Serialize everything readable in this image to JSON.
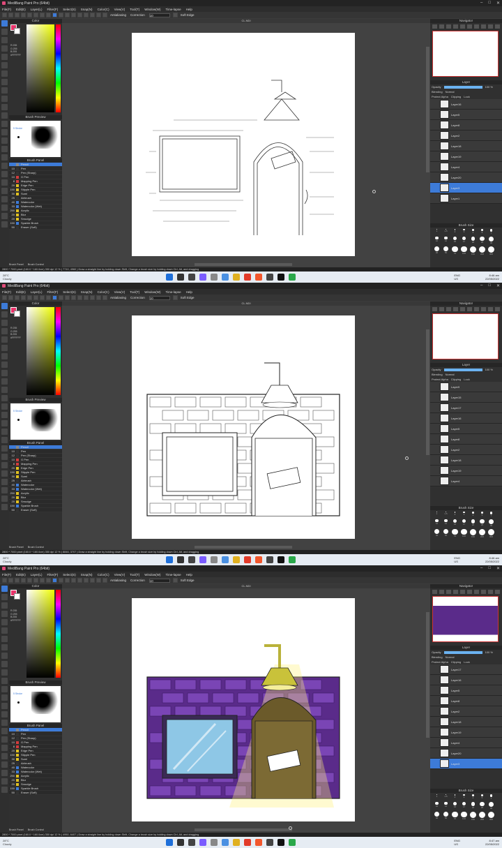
{
  "app": {
    "title": "MediBang Paint Pro (64bit)",
    "menu": [
      "File(F)",
      "Edit(E)",
      "Layer(L)",
      "Filter(F)",
      "Select(S)",
      "Snap(N)",
      "Color(C)",
      "View(V)",
      "Tool(T)",
      "Window(W)",
      "Time-lapse",
      "Help"
    ],
    "toolbar": {
      "antialias": "Antialiasing",
      "correction": "Correction",
      "correction_value": "10",
      "soft_edge": "Soft Edge"
    },
    "canvas_name": "CL.NDI"
  },
  "color_panel": {
    "title": "Color",
    "values": [
      "R:255",
      "G:255",
      "B:255"
    ],
    "hex": "#FFFFFF"
  },
  "brush_preview": {
    "title": "Brush Preview",
    "size": "5 Stroke"
  },
  "brush_panel": {
    "title": "Brush Panel",
    "items": [
      {
        "n": "",
        "name": "Pencil",
        "color": "#888888"
      },
      {
        "n": "10",
        "name": "Pen",
        "color": "#333333"
      },
      {
        "n": "12",
        "name": "Pen (Sharp)",
        "color": "#333333"
      },
      {
        "n": "10",
        "name": "G Pen",
        "color": "#d23b3b"
      },
      {
        "n": "8",
        "name": "Mapping Pen",
        "color": "#d23b3b"
      },
      {
        "n": "20",
        "name": "Edge Pen",
        "color": "#e0c020"
      },
      {
        "n": "150",
        "name": "Stipple Pen",
        "color": "#e0c020"
      },
      {
        "n": "30",
        "name": "Sumi",
        "color": "#e0c020"
      },
      {
        "n": "25",
        "name": "Airbrush",
        "color": "#333333"
      },
      {
        "n": "40",
        "name": "Watercolor",
        "color": "#3d7bd8"
      },
      {
        "n": "33",
        "name": "Watercolor (Wet)",
        "color": "#3d7bd8"
      },
      {
        "n": "250",
        "name": "Acrylic",
        "color": "#e0c020"
      },
      {
        "n": "20",
        "name": "Blur",
        "color": "#e0c020"
      },
      {
        "n": "20",
        "name": "Smudge",
        "color": "#e0c020"
      },
      {
        "n": "150",
        "name": "Sparkle Brush",
        "color": "#3d7bd8"
      },
      {
        "n": "50",
        "name": "Eraser (Soft)",
        "color": "#333333"
      }
    ],
    "tabs": [
      "Brush Panel",
      "Brush Control"
    ]
  },
  "navigator": {
    "title": "Navigator"
  },
  "layer_panel": {
    "title": "Layer",
    "opacity_label": "Opacity",
    "opacity_value": "100 %",
    "blending_label": "Blending",
    "blending_value": "Normal",
    "options": [
      "Protect Alpha",
      "Clipping",
      "Lock"
    ]
  },
  "brush_size": {
    "title": "Brush Size",
    "sizes": [
      "1",
      "1.5",
      "2",
      "3",
      "4",
      "5",
      "7",
      "10",
      "12",
      "15",
      "17",
      "20",
      "25",
      "30",
      "40",
      "50",
      "70",
      "100",
      "150",
      "200",
      "300"
    ]
  },
  "screens": [
    {
      "status": "2800 * 7000 pixel  (160.0 * 160.0cm)  350 dpi  12 %  ( 7710, 4960 )  Draw a straight line by holding down Shift, Change a brush size by holding down Ctrl, Alt, and dragging",
      "layers": [
        {
          "name": "Layer16",
          "selected": false
        },
        {
          "name": "Layer5",
          "selected": false
        },
        {
          "name": "Layer8",
          "selected": false
        },
        {
          "name": "Layer2",
          "selected": false
        },
        {
          "name": "Layer18",
          "selected": false
        },
        {
          "name": "Layer19",
          "selected": false
        },
        {
          "name": "Layer4",
          "selected": false
        },
        {
          "name": "Layer20",
          "selected": false
        },
        {
          "name": "Layer3",
          "selected": true
        },
        {
          "name": "Layer1",
          "selected": false
        }
      ],
      "time": "8:46 am",
      "date": "22/05/2022"
    },
    {
      "status": "2800 * 7000 pixel  (160.0 * 160.0cm)  350 dpi  12 %  ( 8846, 3707 )  Draw a straight line by holding down Shift, Change a brush size by holding down Ctrl, Alt, and dragging",
      "layers": [
        {
          "name": "Layer9",
          "selected": false
        },
        {
          "name": "Layer15",
          "selected": false
        },
        {
          "name": "Layer17",
          "selected": false
        },
        {
          "name": "Layer16",
          "selected": false
        },
        {
          "name": "Layer5",
          "selected": false
        },
        {
          "name": "Layer8",
          "selected": false
        },
        {
          "name": "Layer2",
          "selected": false
        },
        {
          "name": "Layer18",
          "selected": false
        },
        {
          "name": "Layer19",
          "selected": false
        },
        {
          "name": "Layer4",
          "selected": false
        }
      ],
      "time": "8:46 am",
      "date": "22/05/2022"
    },
    {
      "status": "2800 * 7000 pixel  (160.0 * 160.0cm)  350 dpi  12 %  ( 4950, 6407 )  Draw a straight line by holding down Shift, Change a brush size by holding down Ctrl, Alt, and dragging",
      "layers": [
        {
          "name": "Layer17",
          "selected": false
        },
        {
          "name": "Layer16",
          "selected": false
        },
        {
          "name": "Layer5",
          "selected": false
        },
        {
          "name": "Layer8",
          "selected": false
        },
        {
          "name": "Layer2",
          "selected": false
        },
        {
          "name": "Layer18",
          "selected": false
        },
        {
          "name": "Layer19",
          "selected": false
        },
        {
          "name": "Layer4",
          "selected": false
        },
        {
          "name": "Layer20",
          "selected": false
        },
        {
          "name": "Layer3",
          "selected": true
        }
      ],
      "time": "8:47 am",
      "date": "22/05/2022"
    }
  ],
  "taskbar": {
    "weather_temp": "28°C",
    "weather_desc": "Cloudy",
    "lang": "ENG",
    "region": "US"
  }
}
